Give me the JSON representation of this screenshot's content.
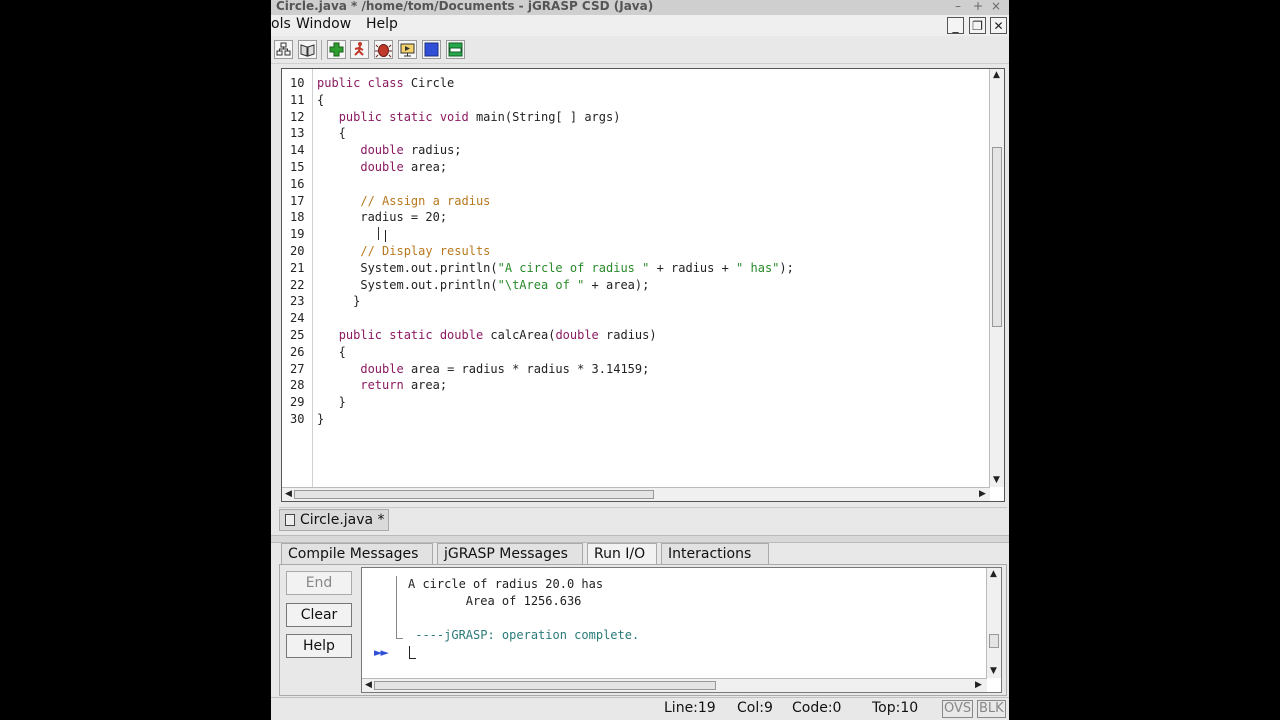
{
  "window": {
    "title": ": Circle.java *  /home/tom/Documents - jGRASP CSD (Java)",
    "title_controls": [
      "–",
      "+",
      "×"
    ]
  },
  "menubar": {
    "items": [
      "ols",
      "Window",
      "Help"
    ],
    "controls": [
      "_",
      "❐",
      "✕"
    ]
  },
  "toolbar": {
    "tools": [
      {
        "icon": "project-tree-icon"
      },
      {
        "icon": "book-icon"
      },
      {
        "icon": "compile-plus-icon",
        "color": "#2e9e2e"
      },
      {
        "icon": "run-runner-icon",
        "color": "#c0392b"
      },
      {
        "icon": "debug-bug-icon",
        "color": "#c0392b"
      },
      {
        "icon": "applet-viewer-icon",
        "color": "#d4a017"
      },
      {
        "icon": "blue-square-icon",
        "color": "#2f4fd6"
      },
      {
        "icon": "window-panel-icon",
        "color": "#27a84a"
      }
    ]
  },
  "editor": {
    "lines": [
      {
        "n": "10",
        "html": "<span class='kw'>public class</span> Circle"
      },
      {
        "n": "11",
        "html": "{"
      },
      {
        "n": "12",
        "html": "   <span class='kw'>public static void</span> main(String[ ] args)"
      },
      {
        "n": "13",
        "html": "   {"
      },
      {
        "n": "14",
        "html": "      <span class='kw'>double</span> radius;"
      },
      {
        "n": "15",
        "html": "      <span class='kw'>double</span> area;"
      },
      {
        "n": "16",
        "html": ""
      },
      {
        "n": "17",
        "html": "      <span class='cm'>// Assign a radius</span>"
      },
      {
        "n": "18",
        "html": "      radius = 20;"
      },
      {
        "n": "19",
        "html": "      "
      },
      {
        "n": "20",
        "html": "      <span class='cm'>// Display results</span>"
      },
      {
        "n": "21",
        "html": "      System.out.println(<span class='str'>\"A circle of radius \"</span> + radius + <span class='str'>\" has\"</span>);"
      },
      {
        "n": "22",
        "html": "      System.out.println(<span class='str'>\"\\tArea of \"</span> + area);"
      },
      {
        "n": "23",
        "html": "     }"
      },
      {
        "n": "24",
        "html": ""
      },
      {
        "n": "25",
        "html": "   <span class='kw'>public static double</span> calcArea(<span class='kw'>double</span> radius)"
      },
      {
        "n": "26",
        "html": "   {"
      },
      {
        "n": "27",
        "html": "      <span class='kw'>double</span> area = radius * radius * 3.14159;"
      },
      {
        "n": "28",
        "html": "      <span class='kw'>return</span> area;"
      },
      {
        "n": "29",
        "html": "   }"
      },
      {
        "n": "30",
        "html": "}"
      }
    ]
  },
  "file_tab": {
    "label": "Circle.java *"
  },
  "panel_tabs": [
    "Compile Messages",
    "jGRASP Messages",
    "Run I/O",
    "Interactions"
  ],
  "run_io": {
    "buttons": {
      "end": "End",
      "clear": "Clear",
      "help": "Help"
    },
    "output": [
      "A circle of radius 20.0 has",
      "        Area of 1256.636",
      "",
      " ----jGRASP: operation complete."
    ],
    "prompt_icon": "►►"
  },
  "status": {
    "line": "Line:19",
    "col": "Col:9",
    "code": "Code:0",
    "top": "Top:10",
    "ovs": "OVS",
    "blk": "BLK"
  }
}
